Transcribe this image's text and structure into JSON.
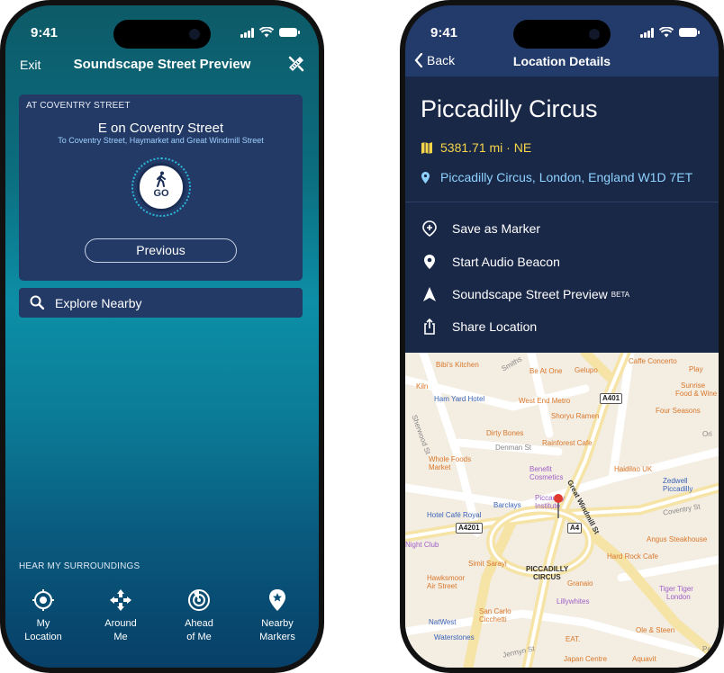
{
  "status": {
    "time": "9:41"
  },
  "preview": {
    "nav": {
      "exit": "Exit",
      "title": "Soundscape Street Preview"
    },
    "card": {
      "street_header": "AT COVENTRY STREET",
      "heading": "E on Coventry Street",
      "subheading": "To Coventry Street, Haymarket and Great Windmill Street",
      "go_label": "GO",
      "previous_label": "Previous"
    },
    "explore_label": "Explore Nearby",
    "hear_header": "HEAR MY SURROUNDINGS",
    "tabs": [
      {
        "line1": "My",
        "line2": "Location",
        "icon": "crosshair-icon"
      },
      {
        "line1": "Around",
        "line2": "Me",
        "icon": "four-arrows-icon"
      },
      {
        "line1": "Ahead",
        "line2": "of Me",
        "icon": "radar-icon"
      },
      {
        "line1": "Nearby",
        "line2": "Markers",
        "icon": "star-pin-icon"
      }
    ]
  },
  "details": {
    "nav": {
      "back": "Back",
      "title": "Location Details"
    },
    "place_name": "Piccadilly Circus",
    "distance": "5381.71 mi · NE",
    "address": "Piccadilly Circus, London, England W1D 7ET",
    "actions": [
      {
        "label": "Save as Marker",
        "badge": "",
        "icon": "add-marker-icon"
      },
      {
        "label": "Start Audio Beacon",
        "badge": "",
        "icon": "pin-icon"
      },
      {
        "label": "Soundscape Street Preview",
        "badge": "BETA",
        "icon": "navigation-arrow-icon"
      },
      {
        "label": "Share Location",
        "badge": "",
        "icon": "share-icon"
      }
    ],
    "map": {
      "center_label_1": "PICCADILLY",
      "center_label_2": "CIRCUS",
      "pois": [
        {
          "t": "Bibi's Kitchen",
          "c": "o"
        },
        {
          "t": "Be At One",
          "c": "o"
        },
        {
          "t": "Gelupo",
          "c": "o"
        },
        {
          "t": "Caffe Concerto",
          "c": "o"
        },
        {
          "t": "Play",
          "c": "o"
        },
        {
          "t": "Kiln",
          "c": "o"
        },
        {
          "t": "Ham Yard Hotel",
          "c": "b"
        },
        {
          "t": "West End Metro",
          "c": "o"
        },
        {
          "t": "Sunrise",
          "c": "o"
        },
        {
          "t": "Food & Wine",
          "c": "o"
        },
        {
          "t": "Shoryu Ramen",
          "c": "o"
        },
        {
          "t": "Four Seasons",
          "c": "o"
        },
        {
          "t": "Dirty Bones",
          "c": "o"
        },
        {
          "t": "Rainforest Cafe",
          "c": "o"
        },
        {
          "t": "Whole Foods",
          "c": "o"
        },
        {
          "t": "Market",
          "c": "o"
        },
        {
          "t": "Benefit",
          "c": "p"
        },
        {
          "t": "Cosmetics",
          "c": "p"
        },
        {
          "t": "Haidilao UK",
          "c": "o"
        },
        {
          "t": "Zedwell",
          "c": "b"
        },
        {
          "t": "Piccadilly",
          "c": "b"
        },
        {
          "t": "Barclays",
          "c": "b"
        },
        {
          "t": "Piccadilly",
          "c": "p"
        },
        {
          "t": "Institute",
          "c": "p"
        },
        {
          "t": "Hotel Café Royal",
          "c": "b"
        },
        {
          "t": "Night Club",
          "c": "p"
        },
        {
          "t": "Angus Steakhouse",
          "c": "o"
        },
        {
          "t": "Simit Sarayi",
          "c": "o"
        },
        {
          "t": "Hard Rock Cafe",
          "c": "o"
        },
        {
          "t": "Hawksmoor",
          "c": "o"
        },
        {
          "t": "Air Street",
          "c": "o"
        },
        {
          "t": "Granaio",
          "c": "o"
        },
        {
          "t": "Tiger Tiger",
          "c": "p"
        },
        {
          "t": "London",
          "c": "p"
        },
        {
          "t": "Lillywhites",
          "c": "p"
        },
        {
          "t": "San Carlo",
          "c": "o"
        },
        {
          "t": "Cicchetti",
          "c": "o"
        },
        {
          "t": "NatWest",
          "c": "b"
        },
        {
          "t": "Ole & Steen",
          "c": "o"
        },
        {
          "t": "Waterstones",
          "c": "b"
        },
        {
          "t": "EAT.",
          "c": "o"
        },
        {
          "t": "Japan Centre",
          "c": "o"
        },
        {
          "t": "Aquavit",
          "c": "o"
        },
        {
          "t": "Great Windmill St",
          "c": "d"
        },
        {
          "t": "Denman St",
          "c": "rd"
        },
        {
          "t": "Coventry St",
          "c": "rd"
        },
        {
          "t": "Jermyn St",
          "c": "rd"
        },
        {
          "t": "Smiths",
          "c": "rd"
        },
        {
          "t": "Sherwood St",
          "c": "rd"
        },
        {
          "t": "Pant",
          "c": "rd"
        },
        {
          "t": "Ori",
          "c": "rd"
        }
      ],
      "shields": [
        "A401",
        "A4201",
        "A4"
      ]
    }
  }
}
